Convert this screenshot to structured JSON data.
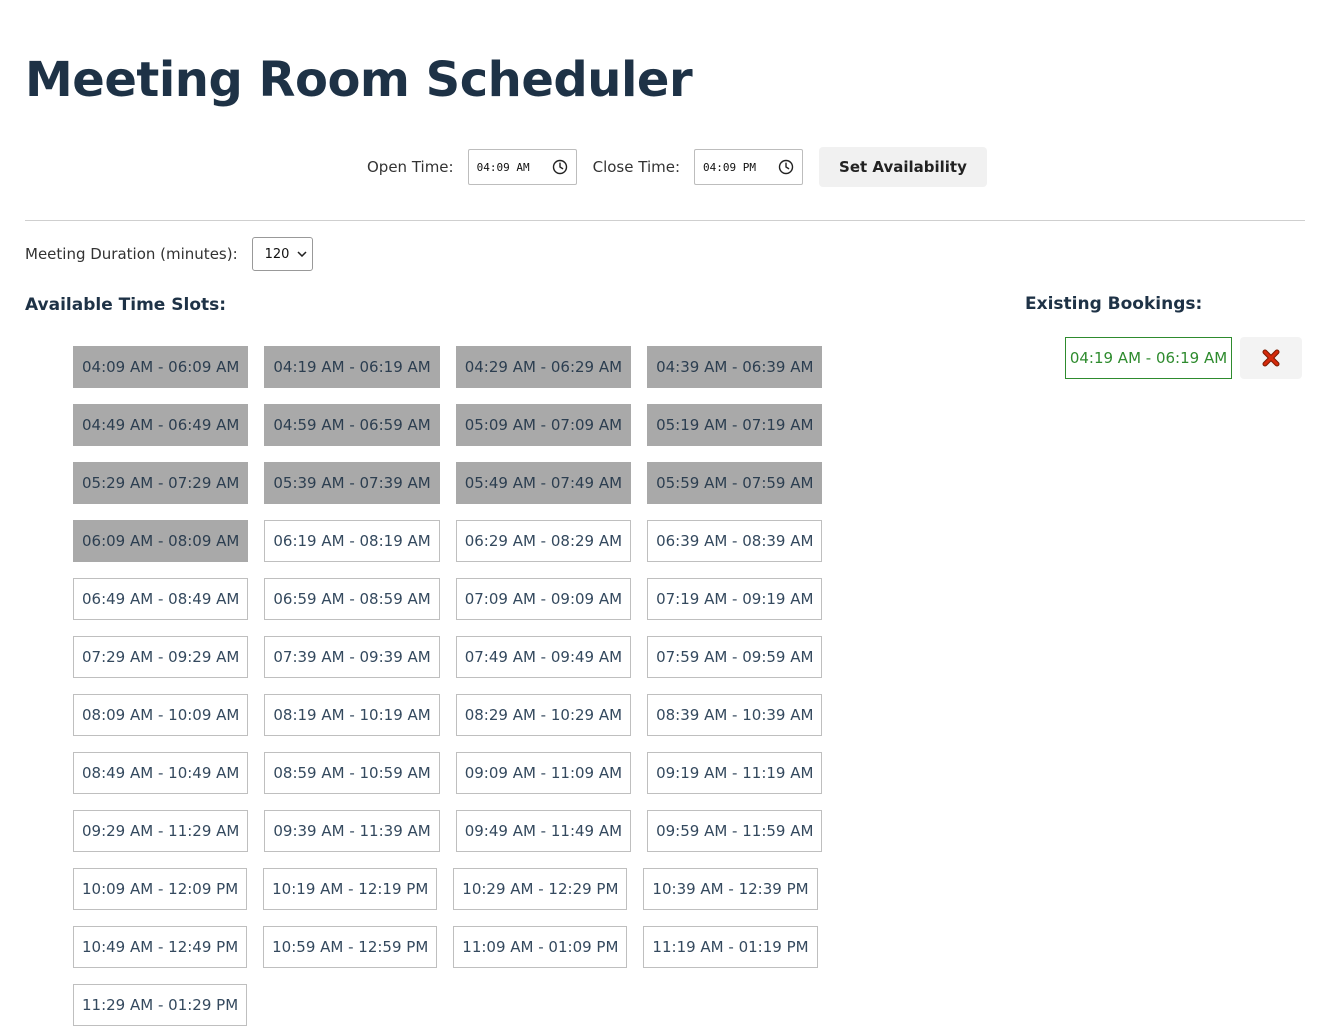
{
  "page": {
    "title": "Meeting Room Scheduler"
  },
  "availability": {
    "open_label": "Open Time:",
    "open_value": "04:09 AM",
    "close_label": "Close Time:",
    "close_value": "04:09 PM",
    "set_button": "Set Availability"
  },
  "duration": {
    "label": "Meeting Duration (minutes):",
    "value": "120"
  },
  "slots_heading": "Available Time Slots:",
  "slots": [
    {
      "label": "04:09 AM - 06:09 AM",
      "booked": true
    },
    {
      "label": "04:19 AM - 06:19 AM",
      "booked": true
    },
    {
      "label": "04:29 AM - 06:29 AM",
      "booked": true
    },
    {
      "label": "04:39 AM - 06:39 AM",
      "booked": true
    },
    {
      "label": "04:49 AM - 06:49 AM",
      "booked": true
    },
    {
      "label": "04:59 AM - 06:59 AM",
      "booked": true
    },
    {
      "label": "05:09 AM - 07:09 AM",
      "booked": true
    },
    {
      "label": "05:19 AM - 07:19 AM",
      "booked": true
    },
    {
      "label": "05:29 AM - 07:29 AM",
      "booked": true
    },
    {
      "label": "05:39 AM - 07:39 AM",
      "booked": true
    },
    {
      "label": "05:49 AM - 07:49 AM",
      "booked": true
    },
    {
      "label": "05:59 AM - 07:59 AM",
      "booked": true
    },
    {
      "label": "06:09 AM - 08:09 AM",
      "booked": true
    },
    {
      "label": "06:19 AM - 08:19 AM",
      "booked": false
    },
    {
      "label": "06:29 AM - 08:29 AM",
      "booked": false
    },
    {
      "label": "06:39 AM - 08:39 AM",
      "booked": false
    },
    {
      "label": "06:49 AM - 08:49 AM",
      "booked": false
    },
    {
      "label": "06:59 AM - 08:59 AM",
      "booked": false
    },
    {
      "label": "07:09 AM - 09:09 AM",
      "booked": false
    },
    {
      "label": "07:19 AM - 09:19 AM",
      "booked": false
    },
    {
      "label": "07:29 AM - 09:29 AM",
      "booked": false
    },
    {
      "label": "07:39 AM - 09:39 AM",
      "booked": false
    },
    {
      "label": "07:49 AM - 09:49 AM",
      "booked": false
    },
    {
      "label": "07:59 AM - 09:59 AM",
      "booked": false
    },
    {
      "label": "08:09 AM - 10:09 AM",
      "booked": false
    },
    {
      "label": "08:19 AM - 10:19 AM",
      "booked": false
    },
    {
      "label": "08:29 AM - 10:29 AM",
      "booked": false
    },
    {
      "label": "08:39 AM - 10:39 AM",
      "booked": false
    },
    {
      "label": "08:49 AM - 10:49 AM",
      "booked": false
    },
    {
      "label": "08:59 AM - 10:59 AM",
      "booked": false
    },
    {
      "label": "09:09 AM - 11:09 AM",
      "booked": false
    },
    {
      "label": "09:19 AM - 11:19 AM",
      "booked": false
    },
    {
      "label": "09:29 AM - 11:29 AM",
      "booked": false
    },
    {
      "label": "09:39 AM - 11:39 AM",
      "booked": false
    },
    {
      "label": "09:49 AM - 11:49 AM",
      "booked": false
    },
    {
      "label": "09:59 AM - 11:59 AM",
      "booked": false
    },
    {
      "label": "10:09 AM - 12:09 PM",
      "booked": false
    },
    {
      "label": "10:19 AM - 12:19 PM",
      "booked": false
    },
    {
      "label": "10:29 AM - 12:29 PM",
      "booked": false
    },
    {
      "label": "10:39 AM - 12:39 PM",
      "booked": false
    },
    {
      "label": "10:49 AM - 12:49 PM",
      "booked": false
    },
    {
      "label": "10:59 AM - 12:59 PM",
      "booked": false
    },
    {
      "label": "11:09 AM - 01:09 PM",
      "booked": false
    },
    {
      "label": "11:19 AM - 01:19 PM",
      "booked": false
    },
    {
      "label": "11:29 AM - 01:29 PM",
      "booked": false
    }
  ],
  "bookings_heading": "Existing Bookings:",
  "bookings": [
    {
      "label": "04:19 AM - 06:19 AM"
    }
  ],
  "colors": {
    "heading": "#1e3246",
    "booked_slot": "#a9a9a9",
    "booking_green": "#2e8b2e",
    "delete_red": "#cc2200"
  },
  "icons": {
    "time_picker": "clock-icon",
    "select_arrow": "chevron-down-icon",
    "delete": "close-x-icon"
  }
}
